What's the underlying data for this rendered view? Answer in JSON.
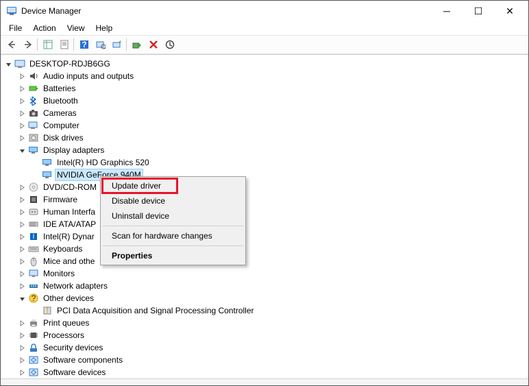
{
  "window": {
    "title": "Device Manager"
  },
  "menubar": [
    "File",
    "Action",
    "View",
    "Help"
  ],
  "tree": {
    "root": "DESKTOP-RDJB6GG",
    "categories": [
      {
        "label": "Audio inputs and outputs",
        "icon": "audio"
      },
      {
        "label": "Batteries",
        "icon": "battery"
      },
      {
        "label": "Bluetooth",
        "icon": "bluetooth"
      },
      {
        "label": "Cameras",
        "icon": "camera"
      },
      {
        "label": "Computer",
        "icon": "computer"
      },
      {
        "label": "Disk drives",
        "icon": "disk"
      },
      {
        "label": "Display adapters",
        "icon": "display",
        "expanded": true,
        "children": [
          {
            "label": "Intel(R) HD Graphics 520",
            "icon": "display"
          },
          {
            "label": "NVIDIA GeForce 940M",
            "icon": "display",
            "selected": true
          }
        ]
      },
      {
        "label": "DVD/CD-ROM",
        "icon": "dvd",
        "truncated": true
      },
      {
        "label": "Firmware",
        "icon": "firmware"
      },
      {
        "label": "Human Interfa",
        "icon": "hid",
        "truncated": true
      },
      {
        "label": "IDE ATA/ATAP",
        "icon": "ide",
        "truncated": true
      },
      {
        "label": "Intel(R) Dynar",
        "icon": "intel",
        "truncated": true
      },
      {
        "label": "Keyboards",
        "icon": "keyboard"
      },
      {
        "label": "Mice and othe",
        "icon": "mouse",
        "truncated": true
      },
      {
        "label": "Monitors",
        "icon": "monitor"
      },
      {
        "label": "Network adapters",
        "icon": "network"
      },
      {
        "label": "Other devices",
        "icon": "other",
        "expanded": true,
        "children": [
          {
            "label": "PCI Data Acquisition and Signal Processing Controller",
            "icon": "unknown"
          }
        ]
      },
      {
        "label": "Print queues",
        "icon": "printer"
      },
      {
        "label": "Processors",
        "icon": "processor"
      },
      {
        "label": "Security devices",
        "icon": "security"
      },
      {
        "label": "Software components",
        "icon": "software"
      },
      {
        "label": "Software devices",
        "icon": "software"
      }
    ]
  },
  "context_menu": {
    "items": [
      {
        "label": "Update driver",
        "highlighted": true
      },
      {
        "label": "Disable device"
      },
      {
        "label": "Uninstall device"
      },
      {
        "sep": true
      },
      {
        "label": "Scan for hardware changes"
      },
      {
        "sep": true
      },
      {
        "label": "Properties",
        "bold": true
      }
    ]
  }
}
